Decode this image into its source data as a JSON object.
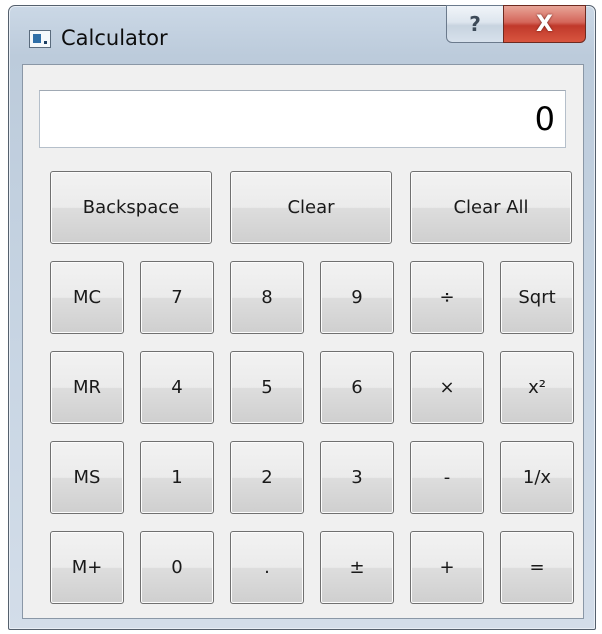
{
  "window": {
    "title": "Calculator",
    "help_label": "?",
    "close_label": "X"
  },
  "display": {
    "value": "0"
  },
  "top_row": [
    "Backspace",
    "Clear",
    "Clear All"
  ],
  "rows": [
    [
      "MC",
      "7",
      "8",
      "9",
      "÷",
      "Sqrt"
    ],
    [
      "MR",
      "4",
      "5",
      "6",
      "×",
      "x²"
    ],
    [
      "MS",
      "1",
      "2",
      "3",
      "-",
      "1/x"
    ],
    [
      "M+",
      "0",
      ".",
      "±",
      "+",
      "="
    ]
  ],
  "colors": {
    "close": "#c0392b",
    "frame": "#bccbdb",
    "client": "#f0f0f0"
  }
}
